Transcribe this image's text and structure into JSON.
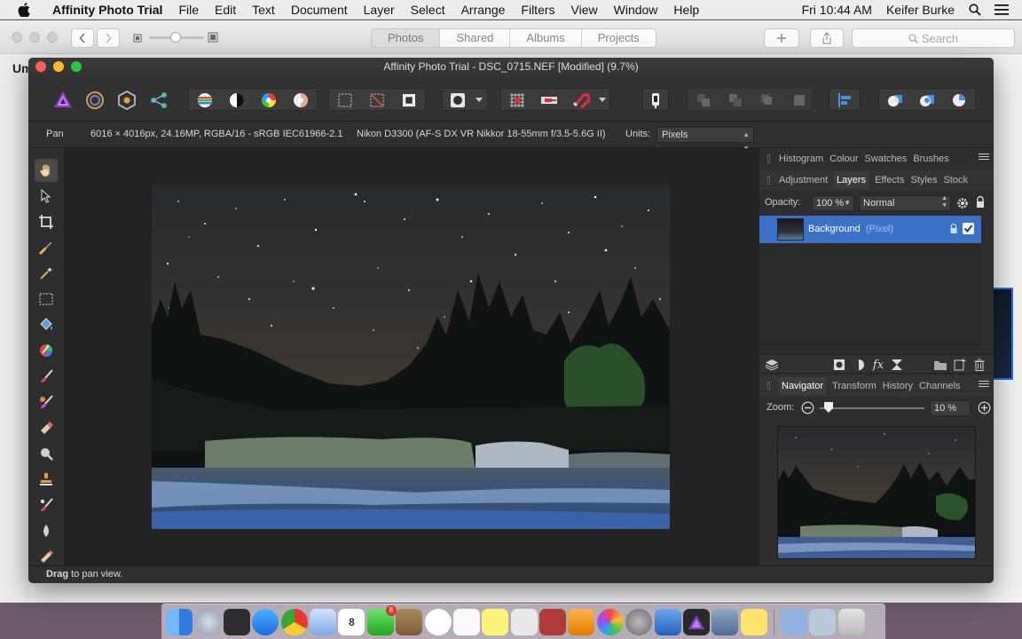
{
  "menubar": {
    "app_name": "Affinity Photo Trial",
    "items": [
      "File",
      "Edit",
      "Text",
      "Document",
      "Layer",
      "Select",
      "Arrange",
      "Filters",
      "View",
      "Window",
      "Help"
    ],
    "clock": "Fri 10:44 AM",
    "user": "Keifer Burke"
  },
  "photos": {
    "tabs": [
      "Photos",
      "Shared",
      "Albums",
      "Projects"
    ],
    "selected_tab": "Photos",
    "search_placeholder": "Search",
    "sidebar_fragment": "Um"
  },
  "affinity": {
    "title": "Affinity Photo Trial - DSC_0715.NEF [Modified] (9.7%)",
    "context": {
      "tool": "Pan",
      "doc_info": "6016 × 4016px, 24.16MP, RGBA/16 - sRGB IEC61966-2.1",
      "camera": "Nikon D3300 (AF-S DX VR Nikkor 18-55mm f/3.5-5.6G II)",
      "units_label": "Units:",
      "units_value": "Pixels"
    },
    "status": {
      "bold": "Drag",
      "rest": " to pan view."
    },
    "tools": [
      "hand-icon",
      "move-icon",
      "crop-icon",
      "selection-brush-icon",
      "flood-select-icon",
      "marquee-icon",
      "flood-fill-icon",
      "color-picker-icon",
      "paint-brush-icon",
      "color-replacement-icon",
      "erase-brush-icon",
      "dodge-icon",
      "clone-icon",
      "healing-icon",
      "blur-icon",
      "patch-icon"
    ]
  },
  "panels": {
    "top_tabs": [
      "Histogram",
      "Colour",
      "Swatches",
      "Brushes"
    ],
    "layer_tabs": [
      "Adjustment",
      "Layers",
      "Effects",
      "Styles",
      "Stock"
    ],
    "layer_tabs_selected": "Layers",
    "opacity_label": "Opacity:",
    "opacity_value": "100 %",
    "blend_mode": "Normal",
    "layer": {
      "name": "Background",
      "type": "(Pixel)"
    },
    "nav_tabs": [
      "Navigator",
      "Transform",
      "History",
      "Channels"
    ],
    "nav_tabs_selected": "Navigator",
    "zoom_label": "Zoom:",
    "zoom_value": "10 %"
  },
  "dock": {
    "mail_badge": "8",
    "calendar_day": "8"
  },
  "colors": {
    "accent": "#3b72c7",
    "panel_bg": "#2e2e2e",
    "canvas_bg": "#232323"
  }
}
